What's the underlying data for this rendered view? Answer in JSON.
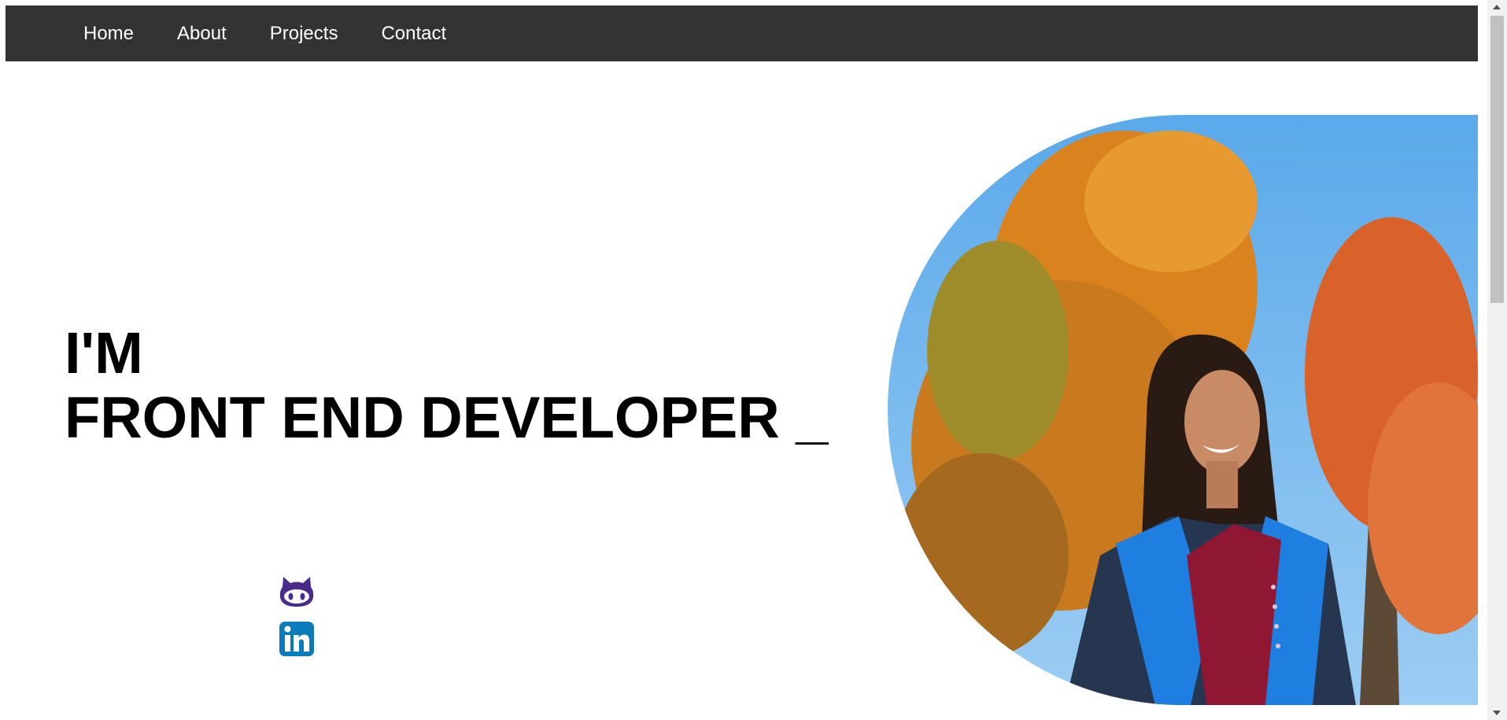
{
  "nav": {
    "items": [
      {
        "label": "Home"
      },
      {
        "label": "About"
      },
      {
        "label": "Projects"
      },
      {
        "label": "Contact"
      }
    ]
  },
  "hero": {
    "line1": "I'M",
    "line2": "FRONT END DEVELOPER _"
  },
  "social": {
    "github_icon": "github-octocat-icon",
    "linkedin_icon": "linkedin-icon"
  },
  "colors": {
    "nav_bg": "#333333",
    "nav_text": "#ffffff",
    "heading": "#000000",
    "github": "#4a2a8a",
    "linkedin": "#0a7bbb"
  }
}
